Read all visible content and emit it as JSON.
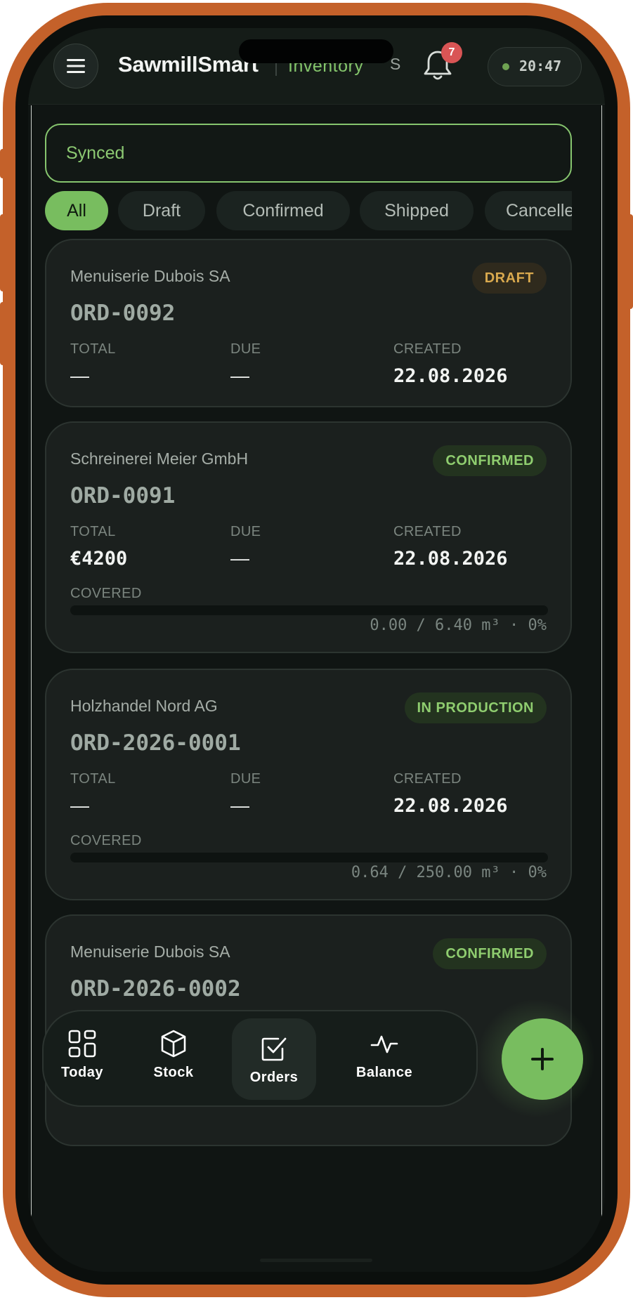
{
  "header": {
    "app_title": "SawmillSmart",
    "section": "Inventory",
    "section_initial": "S",
    "notification_count": "7",
    "clock": "20:47"
  },
  "sync_status": "Synced",
  "filters": [
    {
      "label": "All",
      "active": true
    },
    {
      "label": "Draft",
      "active": false
    },
    {
      "label": "Confirmed",
      "active": false
    },
    {
      "label": "Shipped",
      "active": false
    },
    {
      "label": "Cancelled",
      "active": false
    }
  ],
  "labels": {
    "total": "TOTAL",
    "due": "DUE",
    "created": "CREATED",
    "covered": "COVERED"
  },
  "orders": [
    {
      "customer": "Menuiserie Dubois SA",
      "order_no": "ORD-0092",
      "status": "DRAFT",
      "total": "—",
      "due": "—",
      "created": "22.08.2026"
    },
    {
      "customer": "Schreinerei Meier GmbH",
      "order_no": "ORD-0091",
      "status": "CONFIRMED",
      "total": "€4200",
      "due": "—",
      "created": "22.08.2026",
      "covered_text": "0.00 / 6.40 m³ · 0%",
      "covered_fraction": 0
    },
    {
      "customer": "Holzhandel Nord AG",
      "order_no": "ORD-2026-0001",
      "status": "IN PRODUCTION",
      "total": "—",
      "due": "—",
      "created": "22.08.2026",
      "covered_text": "0.64 / 250.00 m³ · 0%",
      "covered_fraction": 0
    },
    {
      "customer": "Menuiserie Dubois SA",
      "order_no": "ORD-2026-0002",
      "status": "CONFIRMED"
    }
  ],
  "nav": {
    "today": "Today",
    "stock": "Stock",
    "orders": "Orders",
    "balance": "Balance",
    "active": "orders"
  },
  "colors": {
    "frame": "#c4612a",
    "accent": "#78bd5f",
    "draft": "#d9a94e",
    "badge_alert": "#d95555"
  }
}
